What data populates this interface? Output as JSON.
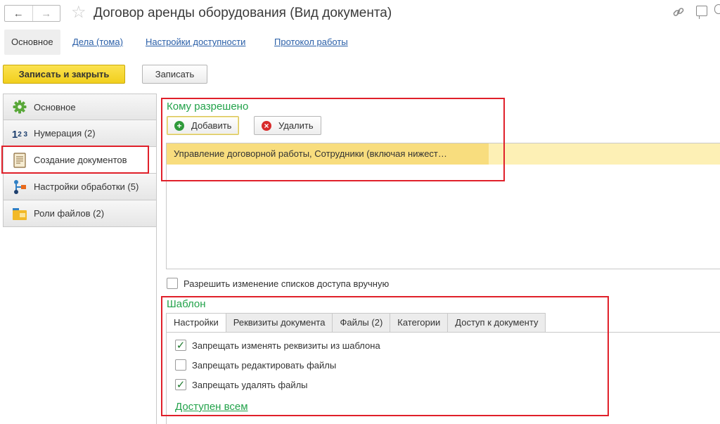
{
  "window": {
    "title": "Договор аренды оборудования (Вид документа)",
    "nav_back": "←",
    "nav_forward": "→",
    "favorite_glyph": "☆",
    "link_glyph": "🔗"
  },
  "top_tabs": [
    {
      "label": "Основное",
      "active": true
    },
    {
      "label": "Дела (тома)",
      "active": false
    },
    {
      "label": "Настройки доступности",
      "active": false
    },
    {
      "label": "Протокол работы",
      "active": false
    }
  ],
  "toolbar": {
    "save_close_label": "Записать и закрыть",
    "save_label": "Записать"
  },
  "sections": [
    {
      "label": "Основное",
      "icon": "gear-icon",
      "active": false
    },
    {
      "label": "Нумерация (2)",
      "icon": "numbering-icon",
      "active": false
    },
    {
      "label": "Создание документов",
      "icon": "document-icon",
      "active": true
    },
    {
      "label": "Настройки обработки (5)",
      "icon": "workflow-icon",
      "active": false
    },
    {
      "label": "Роли файлов (2)",
      "icon": "folder-icon",
      "active": false
    }
  ],
  "numbering_icon_text": {
    "base": "1",
    "sup": "2 3"
  },
  "access": {
    "title": "Кому разрешено",
    "add_label": "Добавить",
    "delete_label": "Удалить",
    "rows": [
      "Управление договорной работы, Сотрудники (включая нижест…"
    ],
    "manual_change_label": "Разрешить изменение списков доступа вручную",
    "manual_change_checked": false
  },
  "template": {
    "title": "Шаблон",
    "tabs": [
      {
        "label": "Настройки",
        "active": true
      },
      {
        "label": "Реквизиты документа",
        "active": false
      },
      {
        "label": "Файлы (2)",
        "active": false
      },
      {
        "label": "Категории",
        "active": false
      },
      {
        "label": "Доступ к документу",
        "active": false
      }
    ],
    "options": [
      {
        "label": "Запрещать изменять реквизиты из шаблона",
        "checked": true
      },
      {
        "label": "Запрещать редактировать файлы",
        "checked": false
      },
      {
        "label": "Запрещать удалять файлы",
        "checked": true
      }
    ],
    "available_link": "Доступен всем"
  },
  "colors": {
    "accent_green": "#22a24a",
    "highlight_red": "#e0202a",
    "primary_button": "#f4d62a",
    "selected_row": "#fdf0b5"
  }
}
